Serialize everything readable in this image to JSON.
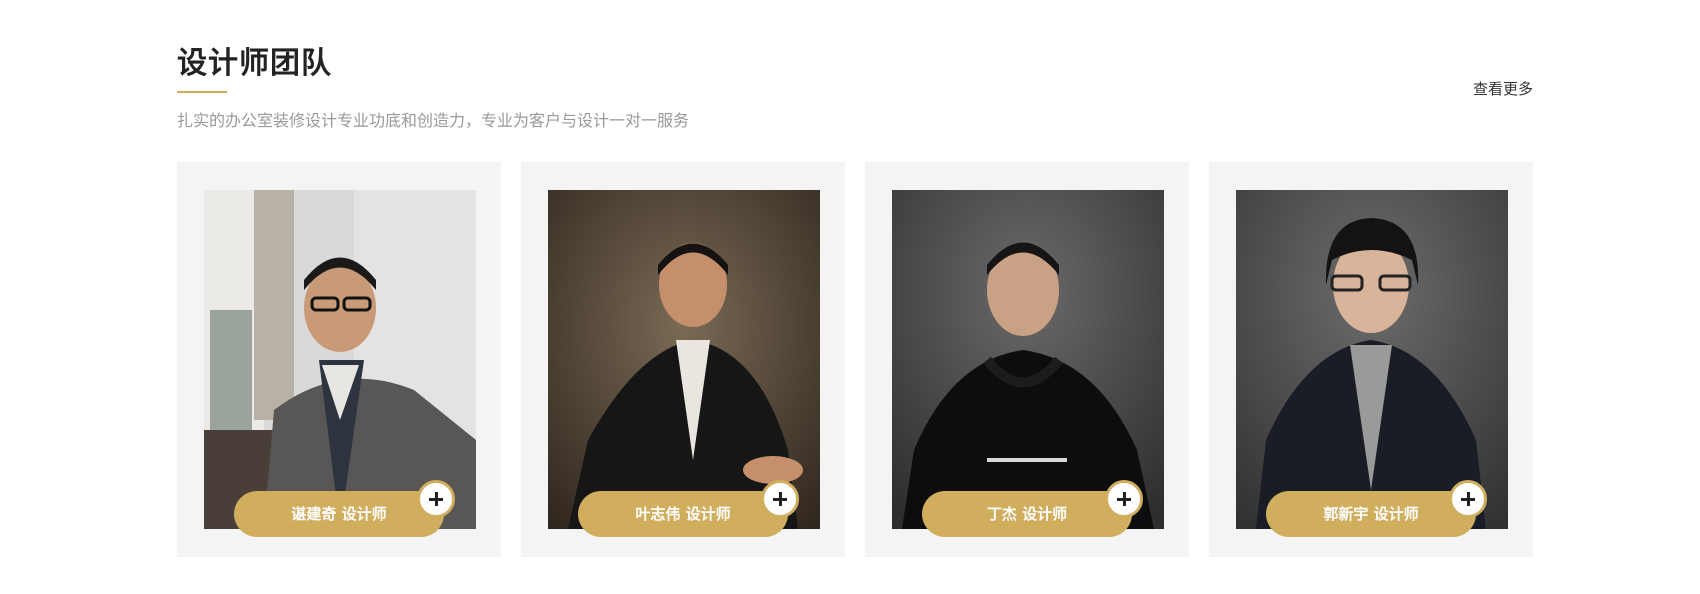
{
  "header": {
    "title": "设计师团队",
    "subtitle": "扎实的办公室装修设计专业功底和创造力，专业为客户与设计一对一服务",
    "more_label": "查看更多",
    "accent_color": "#d1ad5e"
  },
  "designers": [
    {
      "name_label": "谌建奇 设计师",
      "photo_icon": "designer-portrait-1",
      "plus_icon": "plus-icon"
    },
    {
      "name_label": "叶志伟 设计师",
      "photo_icon": "designer-portrait-2",
      "plus_icon": "plus-icon"
    },
    {
      "name_label": "丁杰 设计师",
      "photo_icon": "designer-portrait-3",
      "plus_icon": "plus-icon"
    },
    {
      "name_label": "郭新宇 设计师",
      "photo_icon": "designer-portrait-4",
      "plus_icon": "plus-icon"
    }
  ]
}
